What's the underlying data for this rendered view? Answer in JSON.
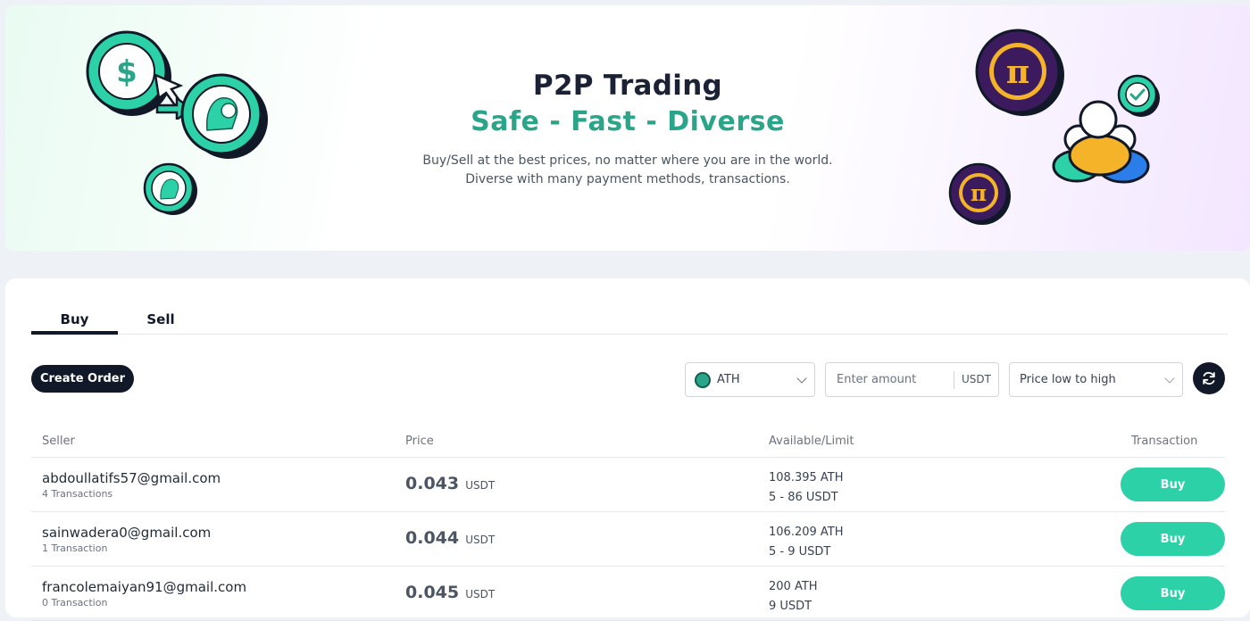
{
  "hero": {
    "title": "P2P Trading",
    "subtitle": "Safe - Fast - Diverse",
    "desc_line1": "Buy/Sell at the best prices, no matter where you are in the world.",
    "desc_line2": "Diverse with many payment methods, transactions."
  },
  "tabs": [
    {
      "label": "Buy",
      "active": true
    },
    {
      "label": "Sell",
      "active": false
    }
  ],
  "toolbar": {
    "create_order_label": "Create Order",
    "coin_selected": "ATH",
    "amount_placeholder": "Enter amount",
    "amount_unit": "USDT",
    "sort_selected": "Price low to high"
  },
  "table": {
    "headers": {
      "seller": "Seller",
      "price": "Price",
      "available": "Available/Limit",
      "transaction": "Transaction"
    },
    "rows": [
      {
        "seller": "abdoullatifs57@gmail.com",
        "transactions": "4 Transactions",
        "price": "0.043",
        "price_unit": "USDT",
        "available": "108.395 ATH",
        "limit": "5 - 86 USDT",
        "action": "Buy"
      },
      {
        "seller": "sainwadera0@gmail.com",
        "transactions": "1 Transaction",
        "price": "0.044",
        "price_unit": "USDT",
        "available": "106.209 ATH",
        "limit": "5 - 9 USDT",
        "action": "Buy"
      },
      {
        "seller": "francolemaiyan91@gmail.com",
        "transactions": "0 Transaction",
        "price": "0.045",
        "price_unit": "USDT",
        "available": "200 ATH",
        "limit": "9 USDT",
        "action": "Buy"
      }
    ]
  },
  "colors": {
    "accent_green": "#2aa58a",
    "buy_button": "#2dd1a8",
    "dark": "#111827",
    "pi_purple": "#3b1b5e",
    "pi_gold": "#f5b329"
  },
  "icons": {
    "dollar_coin": "dollar-coin-icon",
    "athena_coin": "athena-coin-icon",
    "pi_coin": "pi-coin-icon",
    "users": "users-icon",
    "check": "check-badge-icon",
    "refresh": "refresh-icon",
    "chevron": "chevron-down-icon"
  }
}
